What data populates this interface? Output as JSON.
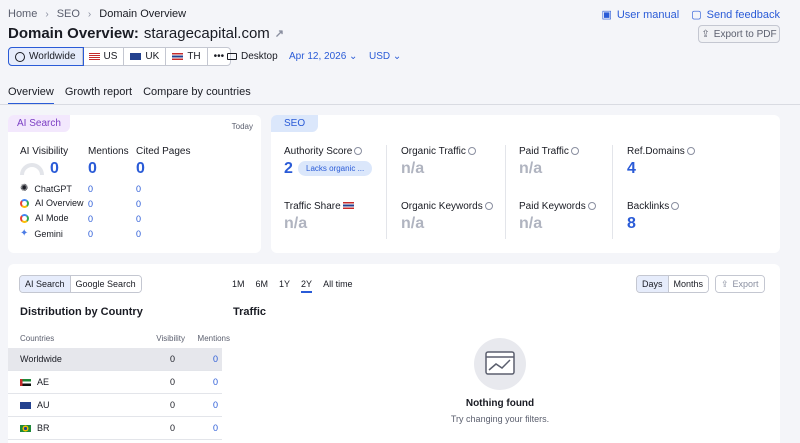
{
  "breadcrumb": {
    "home": "Home",
    "seo": "SEO",
    "current": "Domain Overview"
  },
  "toplinks": {
    "manual": "User manual",
    "feedback": "Send feedback"
  },
  "header": {
    "title": "Domain Overview:",
    "domain": "staragecapital.com",
    "export_pdf": "Export to PDF"
  },
  "db_tabs": [
    "Worldwide",
    "US",
    "UK",
    "TH",
    "•••"
  ],
  "device": "Desktop",
  "date": "Apr 12, 2026",
  "currency": "USD",
  "page_tabs": [
    "Overview",
    "Growth report",
    "Compare by countries"
  ],
  "ai": {
    "tag": "AI Search",
    "period": "Today",
    "visibility_label": "AI Visibility",
    "visibility": "0",
    "mentions_label": "Mentions",
    "mentions": "0",
    "cited_label": "Cited Pages",
    "cited": "0",
    "rows": [
      {
        "name": "ChatGPT",
        "m": "0",
        "c": "0"
      },
      {
        "name": "AI Overview",
        "m": "0",
        "c": "0"
      },
      {
        "name": "AI Mode",
        "m": "0",
        "c": "0"
      },
      {
        "name": "Gemini",
        "m": "0",
        "c": "0"
      }
    ]
  },
  "seo": {
    "tag": "SEO",
    "authority_label": "Authority Score",
    "authority": "2",
    "authority_pill": "Lacks organic ...",
    "organic_traffic_label": "Organic Traffic",
    "organic_traffic": "n/a",
    "paid_traffic_label": "Paid Traffic",
    "paid_traffic": "n/a",
    "refdomains_label": "Ref.Domains",
    "refdomains": "4",
    "traffic_share_label": "Traffic Share",
    "traffic_share": "n/a",
    "organic_kw_label": "Organic Keywords",
    "organic_kw": "n/a",
    "paid_kw_label": "Paid Keywords",
    "paid_kw": "n/a",
    "backlinks_label": "Backlinks",
    "backlinks": "8"
  },
  "bottom": {
    "seg": [
      "AI Search",
      "Google Search"
    ],
    "periods": [
      "1M",
      "6M",
      "1Y",
      "2Y",
      "All time"
    ],
    "units": [
      "Days",
      "Months"
    ],
    "export": "Export",
    "dist_title": "Distribution by Country",
    "traffic_title": "Traffic",
    "cols": [
      "Countries",
      "Visibility",
      "Mentions"
    ],
    "rows": [
      {
        "name": "Worldwide",
        "v": "0",
        "m": "0"
      },
      {
        "name": "AE",
        "v": "0",
        "m": "0"
      },
      {
        "name": "AU",
        "v": "0",
        "m": "0"
      },
      {
        "name": "BR",
        "v": "0",
        "m": "0"
      }
    ],
    "empty_title": "Nothing found",
    "empty_sub": "Try changing your filters."
  }
}
